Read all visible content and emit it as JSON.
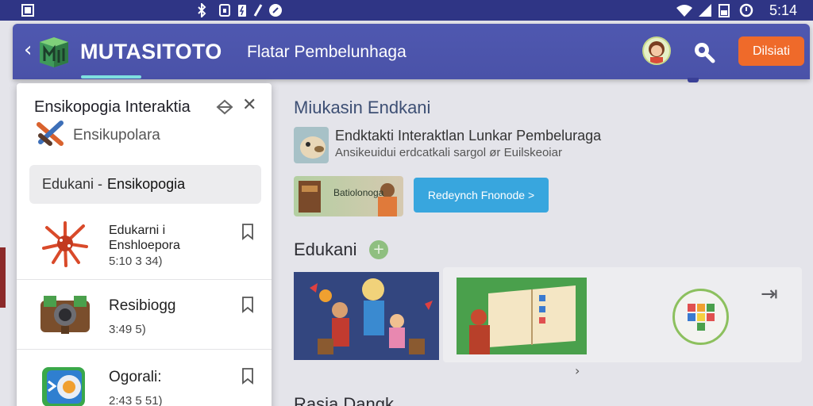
{
  "status_bar": {
    "time": "5:14",
    "left_icons": [
      "photo-icon"
    ],
    "center_icons": [
      "bluetooth-icon",
      "nfc-icon",
      "battery-saver-icon",
      "data-saver-icon"
    ],
    "right_icons": [
      "wifi-icon",
      "signal-icon",
      "battery-icon",
      "alarm-icon"
    ]
  },
  "app_bar": {
    "brand": "MUTASITOTO",
    "subtitle": "Flatar Pembelunhaga",
    "cta_label": "Dilsiati",
    "accent_color": "#ef6a2a",
    "bar_color": "#4a52a8"
  },
  "panel": {
    "title": "Ensikopogia Interaktia",
    "subtitle": "Ensikupolara",
    "selected_prefix": "Edukani -",
    "selected_bold": "Ensikopogia",
    "items": [
      {
        "title": "Edukarni i Enshloepora",
        "meta": "5:10 3 34)"
      },
      {
        "title": "Resibiogg",
        "meta": "3:49 5)"
      },
      {
        "title": "Ogorali:",
        "meta": "2:43 5 51)"
      }
    ]
  },
  "main": {
    "heading": "Miukasin Endkani",
    "featured_title": "Endktakti Interaktlan Lunkar Pembeluraga",
    "featured_sub": "Ansikeuidui erdcatkali sargol ør Euilskeoiar",
    "promo_text": "Batiolonoga",
    "blue_button": "Redeynch Fnonode >",
    "section2": "Edukani",
    "section2_badge": "+",
    "bottom_heading": "Rasia Dangk"
  }
}
